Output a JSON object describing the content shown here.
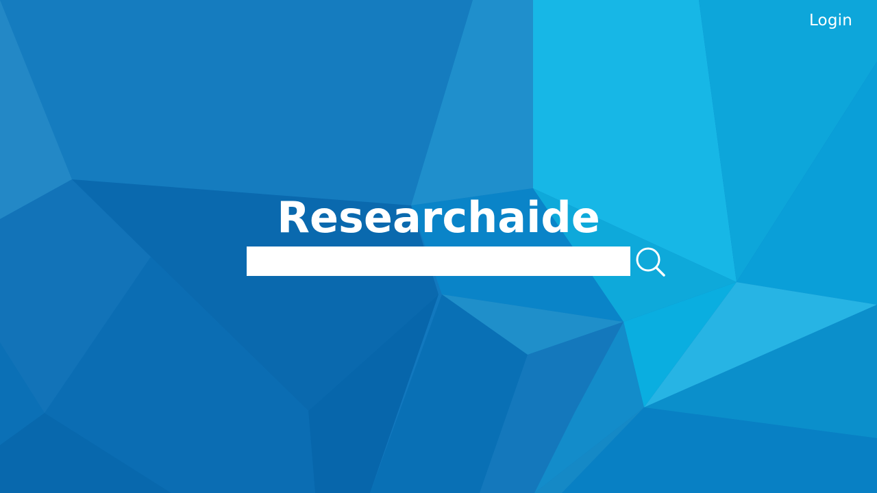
{
  "header": {
    "login_label": "Login"
  },
  "brand": {
    "title": "Researchaide"
  },
  "search": {
    "value": "",
    "placeholder": "",
    "icon": "magnifier-icon"
  },
  "colors": {
    "background": "#1278be",
    "text": "#ffffff",
    "input_background": "#ffffff"
  }
}
